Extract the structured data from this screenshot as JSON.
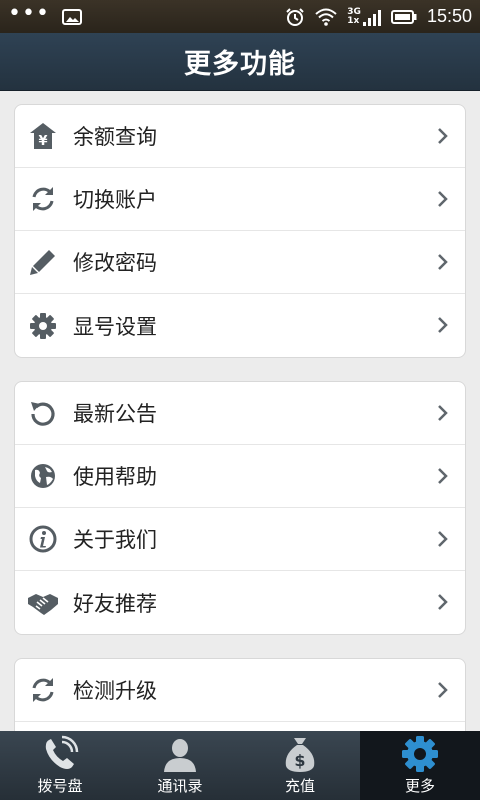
{
  "status_bar": {
    "time": "15:50",
    "network": "3G",
    "network_sub": "1x"
  },
  "header": {
    "title": "更多功能"
  },
  "groups": [
    {
      "items": [
        {
          "label": "余额查询",
          "icon": "balance-icon"
        },
        {
          "label": "切换账户",
          "icon": "refresh-icon"
        },
        {
          "label": "修改密码",
          "icon": "pencil-icon"
        },
        {
          "label": "显号设置",
          "icon": "gear-icon"
        }
      ]
    },
    {
      "items": [
        {
          "label": "最新公告",
          "icon": "rotate-icon"
        },
        {
          "label": "使用帮助",
          "icon": "help-globe-icon"
        },
        {
          "label": "关于我们",
          "icon": "info-icon"
        },
        {
          "label": "好友推荐",
          "icon": "handshake-icon"
        }
      ]
    },
    {
      "items": [
        {
          "label": "检测升级",
          "icon": "refresh-icon"
        }
      ]
    }
  ],
  "tabs": [
    {
      "label": "拨号盘",
      "icon": "phone-icon"
    },
    {
      "label": "通讯录",
      "icon": "contacts-icon"
    },
    {
      "label": "充值",
      "icon": "money-bag-icon"
    },
    {
      "label": "更多",
      "icon": "gear-icon",
      "active": true
    }
  ],
  "colors": {
    "title_bar": "#2f4254",
    "tab_bar": "#262f37",
    "active_tab": "#12171c",
    "icon_gray": "#555d63",
    "active_icon": "#2e8fd0"
  }
}
